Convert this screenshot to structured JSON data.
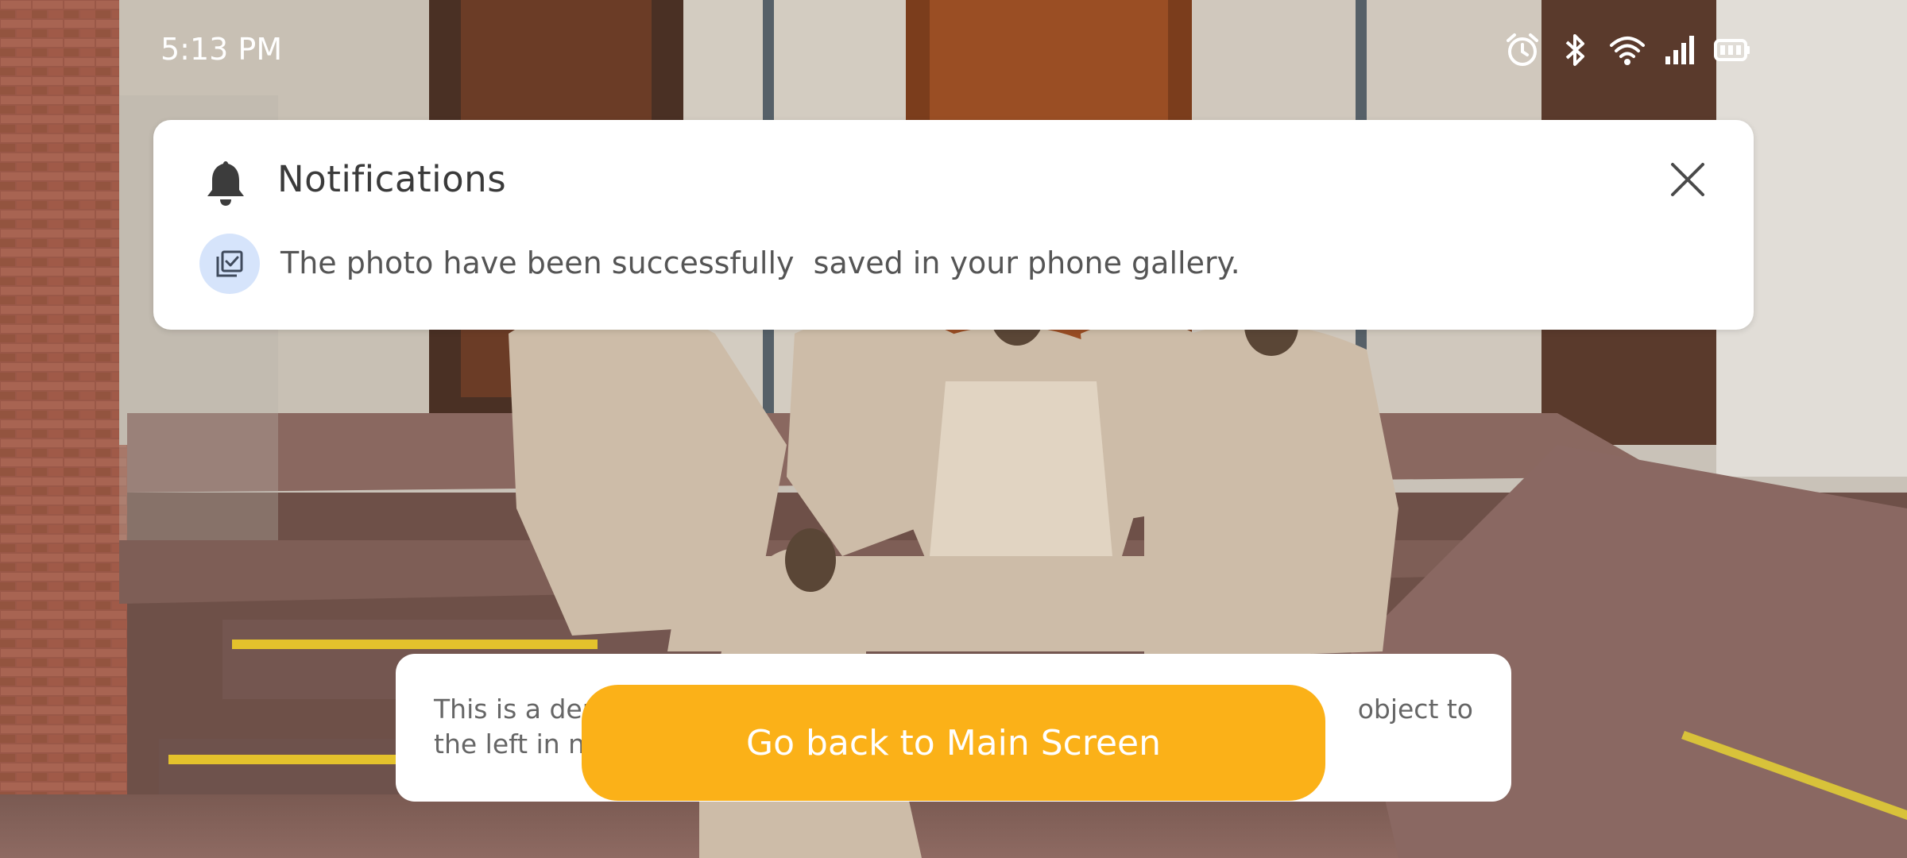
{
  "status_bar": {
    "time": "5:13 PM",
    "icons": [
      "alarm-icon",
      "bluetooth-icon",
      "wifi-icon",
      "signal-icon",
      "battery-icon"
    ]
  },
  "notification": {
    "title": "Notifications",
    "message": "The photo have been successfully  saved in your phone gallery.",
    "icons": {
      "header": "bell-icon",
      "close": "close-icon",
      "message": "gallery-saved-icon"
    }
  },
  "info_card": {
    "line1_left": "This is a der",
    "line1_right": "object to",
    "line2_left": "the left in no"
  },
  "main_button": {
    "label": "Go back to Main Screen"
  },
  "colors": {
    "accent": "#fbb118",
    "card": "#ffffff",
    "icon_badge": "#d6e4fb",
    "text": "#555555"
  }
}
